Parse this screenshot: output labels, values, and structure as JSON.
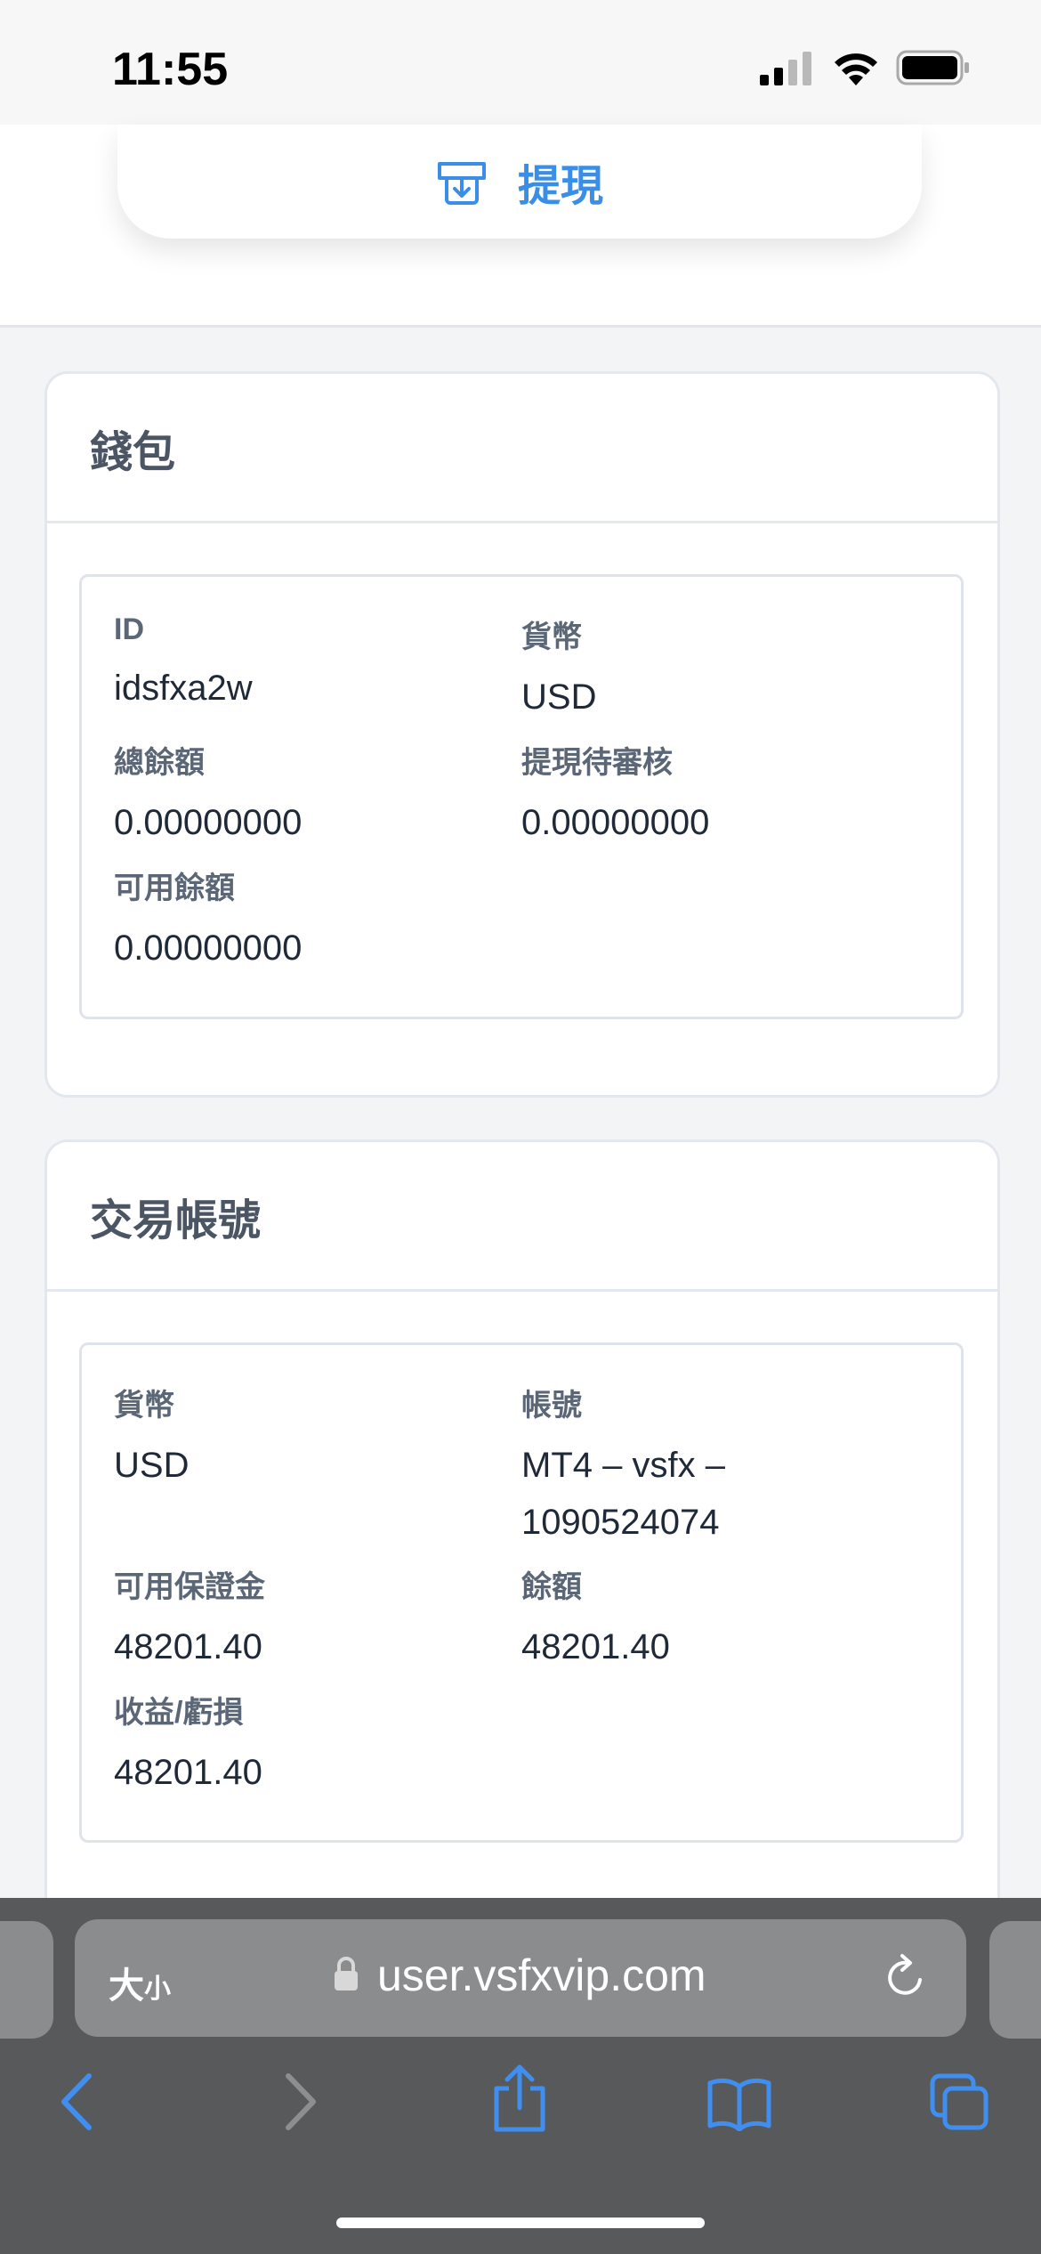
{
  "status_bar": {
    "time": "11:55"
  },
  "top": {
    "withdraw_label": "提現"
  },
  "wallet": {
    "title": "錢包",
    "fields": [
      {
        "label": "ID",
        "value": "idsfxa2w"
      },
      {
        "label": "貨幣",
        "value": "USD"
      },
      {
        "label": "總餘額",
        "value": "0.00000000"
      },
      {
        "label": "提現待審核",
        "value": "0.00000000"
      },
      {
        "label": "可用餘額",
        "value": "0.00000000"
      }
    ]
  },
  "trading": {
    "title": "交易帳號",
    "fields": [
      {
        "label": "貨幣",
        "value": "USD"
      },
      {
        "label": "帳號",
        "value": "MT4 – vsfx –",
        "value2": "1090524074"
      },
      {
        "label": "可用保證金",
        "value": "48201.40"
      },
      {
        "label": "餘額",
        "value": "48201.40"
      },
      {
        "label": "收益/虧損",
        "value": "48201.40"
      }
    ]
  },
  "browser": {
    "text_size_label": "大",
    "text_size_small": "小",
    "url": "user.vsfxvip.com"
  },
  "colors": {
    "accent": "#3a8ee6",
    "chrome": "#58595b",
    "nav_icon": "#3f8ef0"
  },
  "icons": [
    "cellular-signal-icon",
    "wifi-icon",
    "battery-icon",
    "withdraw-tray-icon",
    "lock-icon",
    "reload-icon",
    "back-icon",
    "forward-icon",
    "share-icon",
    "bookmarks-icon",
    "tabs-icon"
  ]
}
